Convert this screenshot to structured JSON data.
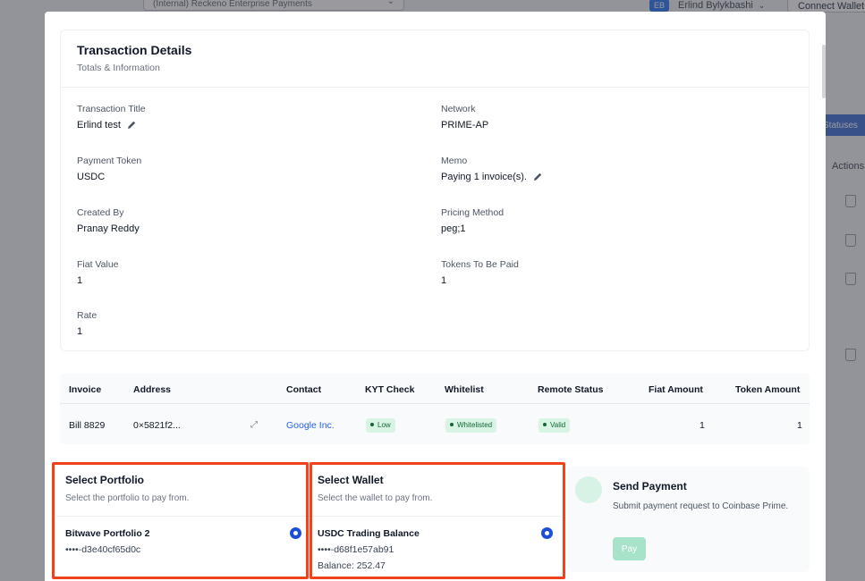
{
  "background": {
    "select_text": "(Internal) Reckeno Enterprise Payments",
    "user_initials": "EB",
    "user_name": "Erlind Bylykbashi",
    "connect_label": "Connect Wallet",
    "tab_label": "Statuses",
    "actions_label": "Actions"
  },
  "details": {
    "title": "Transaction Details",
    "subtitle": "Totals & Information",
    "fields": [
      {
        "label": "Transaction Title",
        "value": "Erlind test",
        "editable": true
      },
      {
        "label": "Network",
        "value": "PRIME-AP",
        "editable": false
      },
      {
        "label": "Payment Token",
        "value": "USDC",
        "editable": false
      },
      {
        "label": "Memo",
        "value": "Paying 1 invoice(s).",
        "editable": true
      },
      {
        "label": "Created By",
        "value": "Pranay Reddy",
        "editable": false
      },
      {
        "label": "Pricing Method",
        "value": "peg;1",
        "editable": false
      },
      {
        "label": "Fiat Value",
        "value": "1",
        "editable": false
      },
      {
        "label": "Tokens To Be Paid",
        "value": "1",
        "editable": false
      },
      {
        "label": "Rate",
        "value": "1",
        "editable": false
      }
    ]
  },
  "invoice_table": {
    "headers": [
      "Invoice",
      "Address",
      "Contact",
      "KYT Check",
      "Whitelist",
      "Remote Status",
      "Fiat Amount",
      "Token Amount"
    ],
    "row": {
      "invoice": "Bill 8829",
      "address": "0×5821f2...",
      "contact": "Google Inc.",
      "kyt_check": "Low",
      "whitelist": "Whitelisted",
      "remote_status": "Valid",
      "fiat_amount": "1",
      "token_amount": "1"
    }
  },
  "portfolio": {
    "title": "Select Portfolio",
    "subtitle": "Select the portfolio to pay from.",
    "option_name": "Bitwave Portfolio 2",
    "option_id": "••••-d3e40cf65d0c",
    "selected": true
  },
  "wallet": {
    "title": "Select Wallet",
    "subtitle": "Select the wallet to pay from.",
    "option_name": "USDC Trading Balance",
    "option_id": "••••-d68f1e57ab91",
    "option_balance": "Balance: 252.47",
    "selected": true
  },
  "send_payment": {
    "title": "Send Payment",
    "description": "Submit payment request to Coinbase Prime.",
    "pay_label": "Pay"
  },
  "colors": {
    "highlight": "#f0431c",
    "accent": "#1d4ed8",
    "link": "#2563eb",
    "status_pill_bg": "#d7f4e4",
    "status_pill_text": "#166534",
    "pay_button": "#a7e3c8"
  }
}
